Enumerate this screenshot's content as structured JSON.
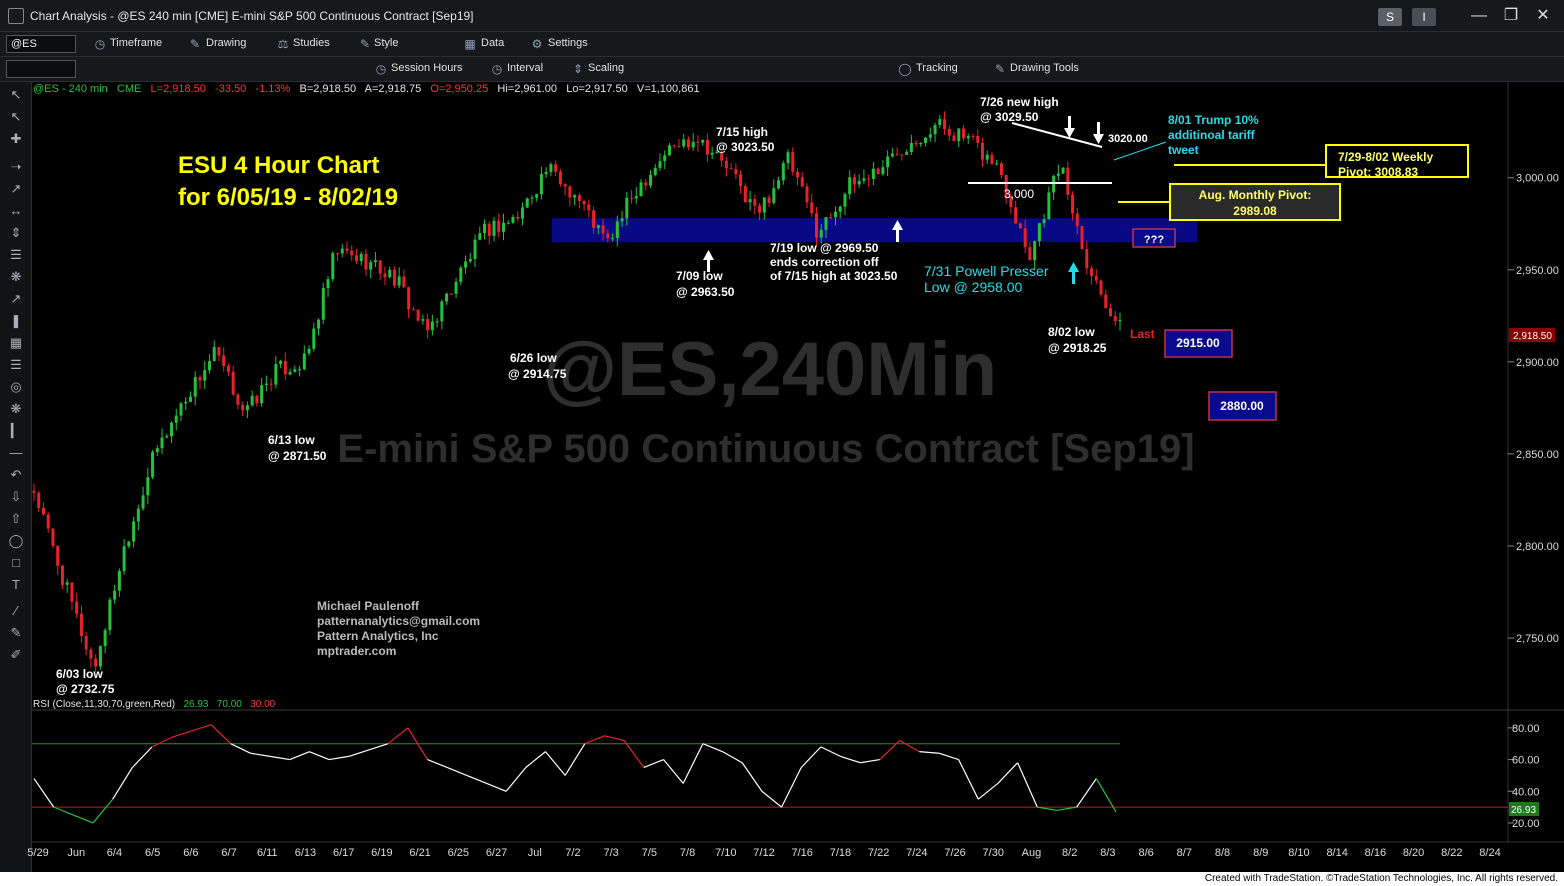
{
  "window": {
    "title": "Chart Analysis - @ES 240 min [CME] E-mini S&P 500 Continuous Contract [Sep19]",
    "btn_s": "S",
    "btn_i": "I"
  },
  "toolbar1": {
    "symbol": "@ES",
    "timeframe": "Timeframe",
    "drawing": "Drawing",
    "studies": "Studies",
    "style": "Style",
    "data": "Data",
    "settings": "Settings"
  },
  "toolbar2": {
    "session_hours": "Session Hours",
    "interval": "Interval",
    "scaling": "Scaling",
    "tracking": "Tracking",
    "drawing_tools": "Drawing Tools"
  },
  "infobar": {
    "symbol": "@ES - 240 min",
    "exchange": "CME",
    "last": "L=2,918.50",
    "change": "-33.50",
    "pct": "-1.13%",
    "bid": "B=2,918.50",
    "ask": "A=2,918.75",
    "open": "O=2,950.25",
    "high": "Hi=2,961.00",
    "low": "Lo=2,917.50",
    "volume": "V=1,100,861"
  },
  "rsi_label": {
    "name": "RSI (Close,11,30,70,green,Red)",
    "value": "26.93",
    "ob": "70.00",
    "os": "30.00"
  },
  "watermark": {
    "symbol": "@ES,240Min",
    "name": "E-mini S&P 500 Continuous Contract [Sep19]"
  },
  "chart_data": {
    "type": "candlestick",
    "title": "ESU 4 Hour Chart",
    "subtitle": "for 6/05/19 - 8/02/19",
    "price_axis": {
      "ticks": [
        2750,
        2800,
        2850,
        2900,
        2950,
        3000
      ],
      "tick_labels": [
        "2,750.00",
        "2,800.00",
        "2,850.00",
        "2,900.00",
        "2,950.00",
        "3,000.00"
      ],
      "range": [
        2712,
        3052
      ],
      "last_price_label": "2,918.50"
    },
    "rsi_axis": {
      "ticks": [
        20,
        40,
        60,
        80
      ],
      "tick_labels": [
        "20.00",
        "40.00",
        "60.00",
        "80.00"
      ],
      "range": [
        8,
        90
      ],
      "overbought": 70,
      "oversold": 30,
      "last_value_label": "26.93"
    },
    "date_axis": [
      "5/29",
      "Jun",
      "6/4",
      "6/5",
      "6/6",
      "6/7",
      "6/11",
      "6/13",
      "6/17",
      "6/19",
      "6/21",
      "6/25",
      "6/27",
      "Jul",
      "7/2",
      "7/3",
      "7/5",
      "7/8",
      "7/10",
      "7/12",
      "7/16",
      "7/18",
      "7/22",
      "7/24",
      "7/26",
      "7/30",
      "Aug",
      "8/2",
      "8/3",
      "8/6",
      "8/7",
      "8/8",
      "8/9",
      "8/10",
      "8/14",
      "8/16",
      "8/20",
      "8/22",
      "8/24"
    ],
    "price_path": [
      {
        "date": "5/29",
        "price": 2830
      },
      {
        "date": "5/31",
        "price": 2780
      },
      {
        "date": "6/3",
        "price": 2733
      },
      {
        "date": "6/4",
        "price": 2800
      },
      {
        "date": "6/6",
        "price": 2850
      },
      {
        "date": "6/7",
        "price": 2880
      },
      {
        "date": "6/10",
        "price": 2905
      },
      {
        "date": "6/13",
        "price": 2872
      },
      {
        "date": "6/14",
        "price": 2895
      },
      {
        "date": "6/18",
        "price": 2900
      },
      {
        "date": "6/20",
        "price": 2960
      },
      {
        "date": "6/21",
        "price": 2955
      },
      {
        "date": "6/24",
        "price": 2945
      },
      {
        "date": "6/26",
        "price": 2915
      },
      {
        "date": "6/28",
        "price": 2945
      },
      {
        "date": "7/1",
        "price": 2972
      },
      {
        "date": "7/2",
        "price": 2978
      },
      {
        "date": "7/3",
        "price": 3005
      },
      {
        "date": "7/5",
        "price": 2990
      },
      {
        "date": "7/9",
        "price": 2964
      },
      {
        "date": "7/10",
        "price": 2995
      },
      {
        "date": "7/12",
        "price": 3015
      },
      {
        "date": "7/15",
        "price": 3023
      },
      {
        "date": "7/17",
        "price": 3005
      },
      {
        "date": "7/18",
        "price": 2980
      },
      {
        "date": "7/19",
        "price": 3010
      },
      {
        "date": "7/22",
        "price": 2970
      },
      {
        "date": "7/23",
        "price": 2995
      },
      {
        "date": "7/24",
        "price": 3005
      },
      {
        "date": "7/25",
        "price": 3020
      },
      {
        "date": "7/26",
        "price": 3029
      },
      {
        "date": "7/29",
        "price": 3020
      },
      {
        "date": "7/30",
        "price": 3005
      },
      {
        "date": "7/31",
        "price": 2958
      },
      {
        "date": "8/1",
        "price": 3008
      },
      {
        "date": "8/1",
        "price": 2950
      },
      {
        "date": "8/2",
        "price": 2918
      }
    ],
    "rsi_path": [
      48,
      30,
      25,
      20,
      35,
      55,
      68,
      74,
      78,
      82,
      70,
      64,
      62,
      60,
      65,
      60,
      62,
      66,
      70,
      80,
      60,
      55,
      50,
      45,
      40,
      55,
      65,
      50,
      70,
      75,
      72,
      55,
      60,
      45,
      70,
      65,
      58,
      40,
      30,
      55,
      68,
      62,
      58,
      60,
      72,
      65,
      64,
      60,
      35,
      45,
      58,
      30,
      28,
      30,
      48,
      26.93
    ],
    "levels": {
      "pivot_weekly": 3008.83,
      "pivot_monthly": 2989.08,
      "support_zone": [
        2965,
        2978
      ],
      "resistance_line": 3000,
      "target_1": 2915,
      "target_2": 2880
    },
    "annotations": {
      "low_0603": [
        "6/03 low",
        "@ 2732.75"
      ],
      "low_0613": [
        "6/13 low",
        "@ 2871.50"
      ],
      "low_0626": [
        "6/26 low",
        "@ 2914.75"
      ],
      "low_0709": [
        "7/09 low",
        "@ 2963.50"
      ],
      "high_0715": [
        "7/15 high",
        "@ 3023.50"
      ],
      "low_0719": [
        "7/19 low @ 2969.50",
        "ends correction off",
        "of 7/15 high at 3023.50"
      ],
      "high_0726": [
        "7/26 new high",
        "@ 3029.50"
      ],
      "lvl_3020": "3020.00",
      "lvl_3000": "3,000",
      "trump": [
        "8/01 Trump 10%",
        "additinoal tariff",
        "tweet"
      ],
      "powell": [
        "7/31 Powell Presser",
        "Low @ 2958.00"
      ],
      "low_0802": [
        "8/02 low",
        "@ 2918.25"
      ],
      "last": "Last",
      "weekly_pivot": [
        "7/29-8/02 Weekly",
        "Pivot: 3008.83"
      ],
      "monthly_pivot": [
        "Aug. Monthly Pivot:",
        "2989.08"
      ],
      "qqq": "???",
      "target_1": "2915.00",
      "target_2": "2880.00",
      "author": [
        "Michael Paulenoff",
        "patternanalytics@gmail.com",
        "Pattern Analytics, Inc",
        "mptrader.com"
      ]
    },
    "colors": {
      "up": "#22c33b",
      "down": "#e8222b",
      "title": "#ffff00",
      "zone": "#000080",
      "cyan": "#22dde8",
      "pivot_box": "#ffff66"
    }
  },
  "footer": "Created with TradeStation. ©TradeStation Technologies, Inc. All rights reserved."
}
